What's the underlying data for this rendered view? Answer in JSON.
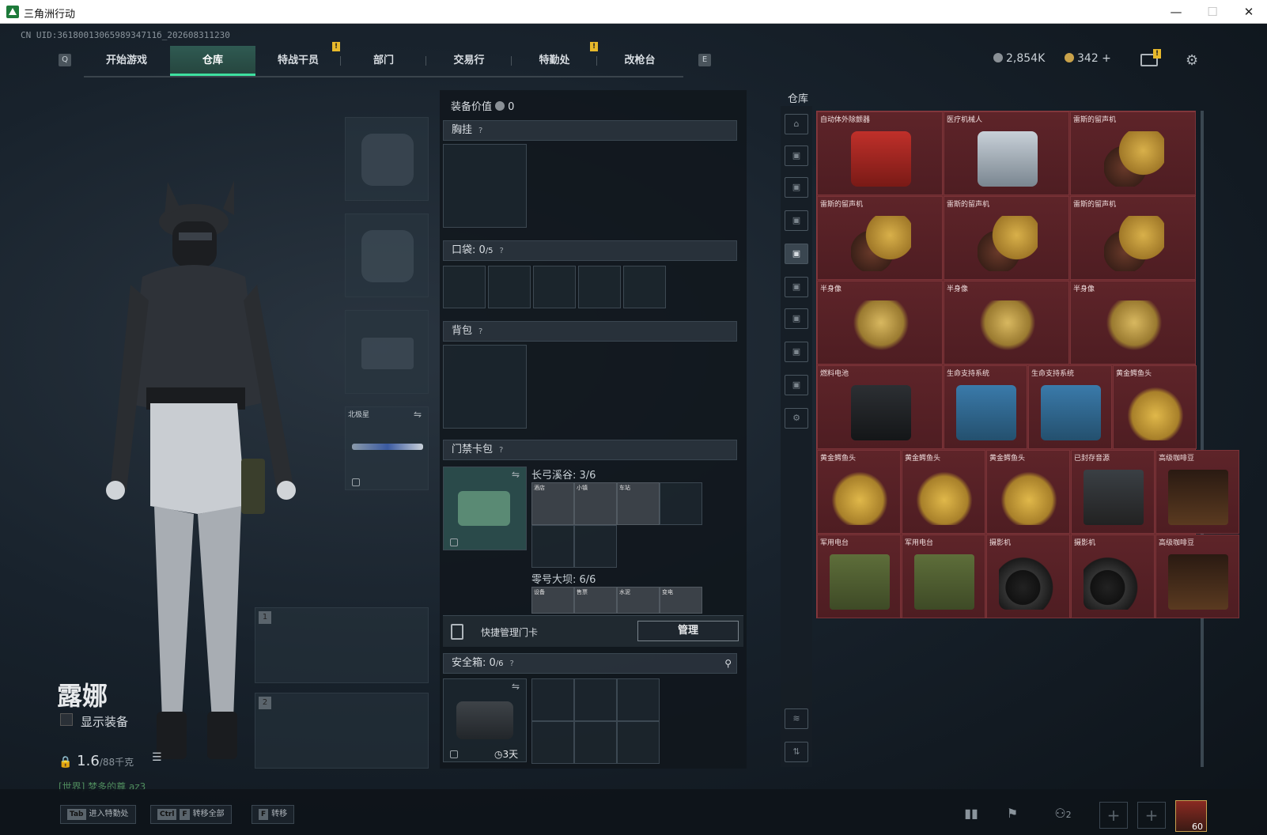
{
  "window": {
    "title": "三角洲行动"
  },
  "uid": "CN UID:3618001306598934711б_202608311230",
  "nav": {
    "q_key": "Q",
    "e_key": "E",
    "tabs": [
      "开始游戏",
      "仓库",
      "特战干员",
      "部门",
      "交易行",
      "特勤处",
      "改枪台"
    ],
    "active": "仓库"
  },
  "currency": {
    "silver": "2,854K",
    "gold": "342 +"
  },
  "character": {
    "name": "露娜",
    "show_equipment": "显示装备",
    "weight": "1.6",
    "weight_max": "/88千克",
    "world_chat": "[世界] 梦多的尊 az3"
  },
  "equipment": {
    "weapon_name": "北极星",
    "slot1": "1",
    "slot2": "2"
  },
  "loadout": {
    "value_label": "装备价值",
    "value": "0",
    "chest_rig": "胸挂",
    "pocket_label": "口袋:",
    "pocket_count": "0",
    "pocket_max": "/5",
    "backpack": "背包",
    "keycard_label": "门禁卡包",
    "map1": "长弓溪谷: 3/6",
    "map1_cards": [
      "酒店",
      "小镇",
      "车站"
    ],
    "map2": "零号大坝: 6/6",
    "map2_cards": [
      "设备",
      "售票",
      "水泥",
      "变电"
    ],
    "quick_manage": "快捷管理门卡",
    "manage_button": "管理",
    "safe_label": "安全箱:",
    "safe_count": "0",
    "safe_max": "/6",
    "safe_timer": "3天"
  },
  "warehouse": {
    "title": "仓库",
    "items": [
      {
        "name": "自动体外除颤器",
        "type": "aed"
      },
      {
        "name": "医疗机械人",
        "type": "robot"
      },
      {
        "name": "雷斯的留声机",
        "type": "gramo"
      },
      {
        "name": "雷斯的留声机",
        "type": "gramo"
      },
      {
        "name": "雷斯的留声机",
        "type": "gramo"
      },
      {
        "name": "雷斯的留声机",
        "type": "gramo"
      },
      {
        "name": "半身像",
        "type": "bust"
      },
      {
        "name": "半身像",
        "type": "bust"
      },
      {
        "name": "半身像",
        "type": "bust"
      },
      {
        "name": "燃料电池",
        "type": "fuel"
      },
      {
        "name": "生命支持系统",
        "type": "engine"
      },
      {
        "name": "生命支持系统",
        "type": "engine"
      },
      {
        "name": "黄金鳄鱼头",
        "type": "croc"
      },
      {
        "name": "黄金鳄鱼头",
        "type": "croc"
      },
      {
        "name": "黄金鳄鱼头",
        "type": "croc"
      },
      {
        "name": "黄金鳄鱼头",
        "type": "croc"
      },
      {
        "name": "已封存音源",
        "type": "reel"
      },
      {
        "name": "高级咖啡豆",
        "type": "coffee"
      },
      {
        "name": "军用电台",
        "type": "radio"
      },
      {
        "name": "军用电台",
        "type": "radio"
      },
      {
        "name": "摄影机",
        "type": "cam"
      },
      {
        "name": "摄影机",
        "type": "cam"
      },
      {
        "name": "高级咖啡豆",
        "type": "coffee"
      }
    ]
  },
  "bottom": {
    "hint1_key": "Tab",
    "hint1": "进入特勤处",
    "hint2_key1": "Ctrl",
    "hint2_key2": "F",
    "hint2": "转移全部",
    "hint3_key": "F",
    "hint3": "转移",
    "squad_count": "2",
    "level": "60"
  }
}
